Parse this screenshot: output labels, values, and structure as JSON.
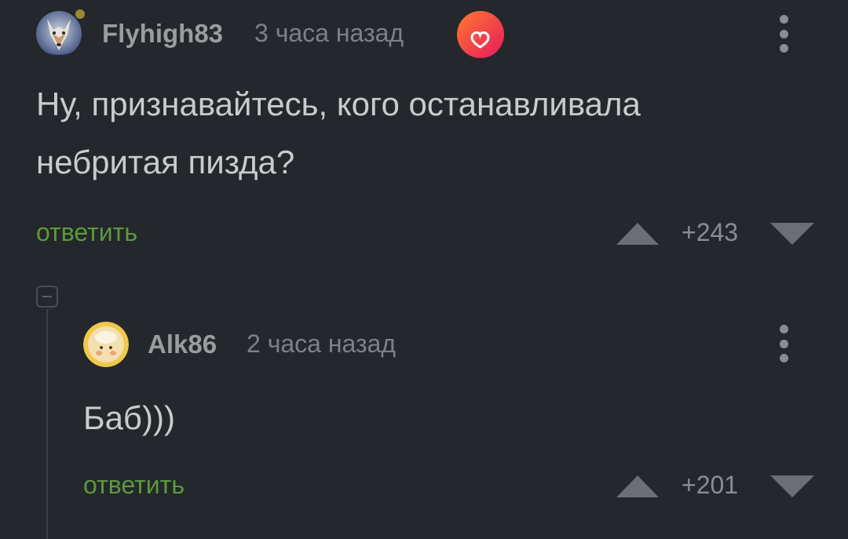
{
  "comments": [
    {
      "username": "Flyhigh83",
      "timestamp": "3 часа назад",
      "text_line1": "Ну, признавайтесь, кого останавливала",
      "text_line2": "небритая пизда?",
      "reply_label": "ответить",
      "score": "+243",
      "avatar_icon": "fox-avatar",
      "badge_icon": "heart-badge-icon"
    },
    {
      "username": "Alk86",
      "timestamp": "2 часа назад",
      "text_line1": "Баб)))",
      "reply_label": "ответить",
      "score": "+201",
      "avatar_icon": "cartoon-avatar"
    }
  ],
  "colors": {
    "background": "#24272b",
    "reply_link": "#5b9a3c",
    "text": "#c9cbcd",
    "muted": "#7d8084",
    "badge_gradient": [
      "#ff6a3d",
      "#e8185d"
    ]
  }
}
